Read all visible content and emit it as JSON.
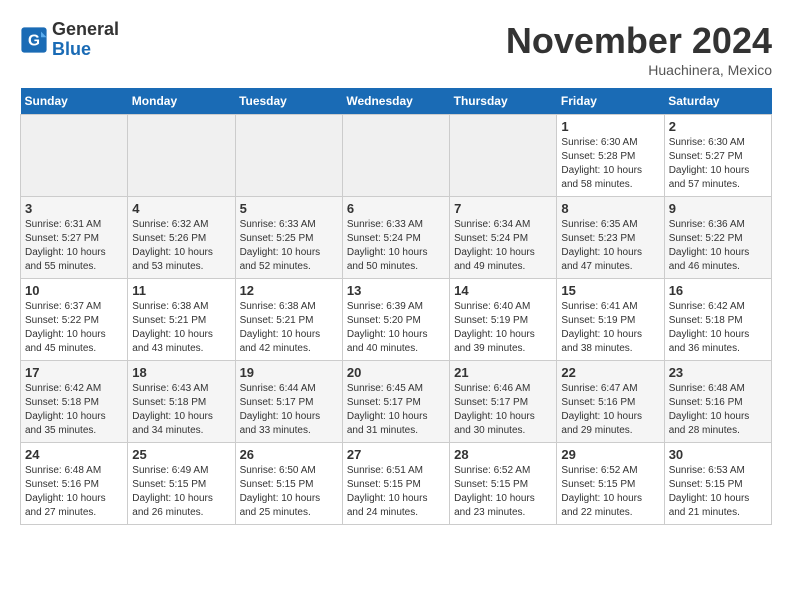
{
  "logo": {
    "line1": "General",
    "line2": "Blue"
  },
  "title": "November 2024",
  "location": "Huachinera, Mexico",
  "days_of_week": [
    "Sunday",
    "Monday",
    "Tuesday",
    "Wednesday",
    "Thursday",
    "Friday",
    "Saturday"
  ],
  "weeks": [
    [
      {
        "day": "",
        "empty": true
      },
      {
        "day": "",
        "empty": true
      },
      {
        "day": "",
        "empty": true
      },
      {
        "day": "",
        "empty": true
      },
      {
        "day": "",
        "empty": true
      },
      {
        "day": "1",
        "sunrise": "6:30 AM",
        "sunset": "5:28 PM",
        "daylight": "10 hours and 58 minutes."
      },
      {
        "day": "2",
        "sunrise": "6:30 AM",
        "sunset": "5:27 PM",
        "daylight": "10 hours and 57 minutes."
      }
    ],
    [
      {
        "day": "3",
        "sunrise": "6:31 AM",
        "sunset": "5:27 PM",
        "daylight": "10 hours and 55 minutes."
      },
      {
        "day": "4",
        "sunrise": "6:32 AM",
        "sunset": "5:26 PM",
        "daylight": "10 hours and 53 minutes."
      },
      {
        "day": "5",
        "sunrise": "6:33 AM",
        "sunset": "5:25 PM",
        "daylight": "10 hours and 52 minutes."
      },
      {
        "day": "6",
        "sunrise": "6:33 AM",
        "sunset": "5:24 PM",
        "daylight": "10 hours and 50 minutes."
      },
      {
        "day": "7",
        "sunrise": "6:34 AM",
        "sunset": "5:24 PM",
        "daylight": "10 hours and 49 minutes."
      },
      {
        "day": "8",
        "sunrise": "6:35 AM",
        "sunset": "5:23 PM",
        "daylight": "10 hours and 47 minutes."
      },
      {
        "day": "9",
        "sunrise": "6:36 AM",
        "sunset": "5:22 PM",
        "daylight": "10 hours and 46 minutes."
      }
    ],
    [
      {
        "day": "10",
        "sunrise": "6:37 AM",
        "sunset": "5:22 PM",
        "daylight": "10 hours and 45 minutes."
      },
      {
        "day": "11",
        "sunrise": "6:38 AM",
        "sunset": "5:21 PM",
        "daylight": "10 hours and 43 minutes."
      },
      {
        "day": "12",
        "sunrise": "6:38 AM",
        "sunset": "5:21 PM",
        "daylight": "10 hours and 42 minutes."
      },
      {
        "day": "13",
        "sunrise": "6:39 AM",
        "sunset": "5:20 PM",
        "daylight": "10 hours and 40 minutes."
      },
      {
        "day": "14",
        "sunrise": "6:40 AM",
        "sunset": "5:19 PM",
        "daylight": "10 hours and 39 minutes."
      },
      {
        "day": "15",
        "sunrise": "6:41 AM",
        "sunset": "5:19 PM",
        "daylight": "10 hours and 38 minutes."
      },
      {
        "day": "16",
        "sunrise": "6:42 AM",
        "sunset": "5:18 PM",
        "daylight": "10 hours and 36 minutes."
      }
    ],
    [
      {
        "day": "17",
        "sunrise": "6:42 AM",
        "sunset": "5:18 PM",
        "daylight": "10 hours and 35 minutes."
      },
      {
        "day": "18",
        "sunrise": "6:43 AM",
        "sunset": "5:18 PM",
        "daylight": "10 hours and 34 minutes."
      },
      {
        "day": "19",
        "sunrise": "6:44 AM",
        "sunset": "5:17 PM",
        "daylight": "10 hours and 33 minutes."
      },
      {
        "day": "20",
        "sunrise": "6:45 AM",
        "sunset": "5:17 PM",
        "daylight": "10 hours and 31 minutes."
      },
      {
        "day": "21",
        "sunrise": "6:46 AM",
        "sunset": "5:17 PM",
        "daylight": "10 hours and 30 minutes."
      },
      {
        "day": "22",
        "sunrise": "6:47 AM",
        "sunset": "5:16 PM",
        "daylight": "10 hours and 29 minutes."
      },
      {
        "day": "23",
        "sunrise": "6:48 AM",
        "sunset": "5:16 PM",
        "daylight": "10 hours and 28 minutes."
      }
    ],
    [
      {
        "day": "24",
        "sunrise": "6:48 AM",
        "sunset": "5:16 PM",
        "daylight": "10 hours and 27 minutes."
      },
      {
        "day": "25",
        "sunrise": "6:49 AM",
        "sunset": "5:15 PM",
        "daylight": "10 hours and 26 minutes."
      },
      {
        "day": "26",
        "sunrise": "6:50 AM",
        "sunset": "5:15 PM",
        "daylight": "10 hours and 25 minutes."
      },
      {
        "day": "27",
        "sunrise": "6:51 AM",
        "sunset": "5:15 PM",
        "daylight": "10 hours and 24 minutes."
      },
      {
        "day": "28",
        "sunrise": "6:52 AM",
        "sunset": "5:15 PM",
        "daylight": "10 hours and 23 minutes."
      },
      {
        "day": "29",
        "sunrise": "6:52 AM",
        "sunset": "5:15 PM",
        "daylight": "10 hours and 22 minutes."
      },
      {
        "day": "30",
        "sunrise": "6:53 AM",
        "sunset": "5:15 PM",
        "daylight": "10 hours and 21 minutes."
      }
    ]
  ]
}
